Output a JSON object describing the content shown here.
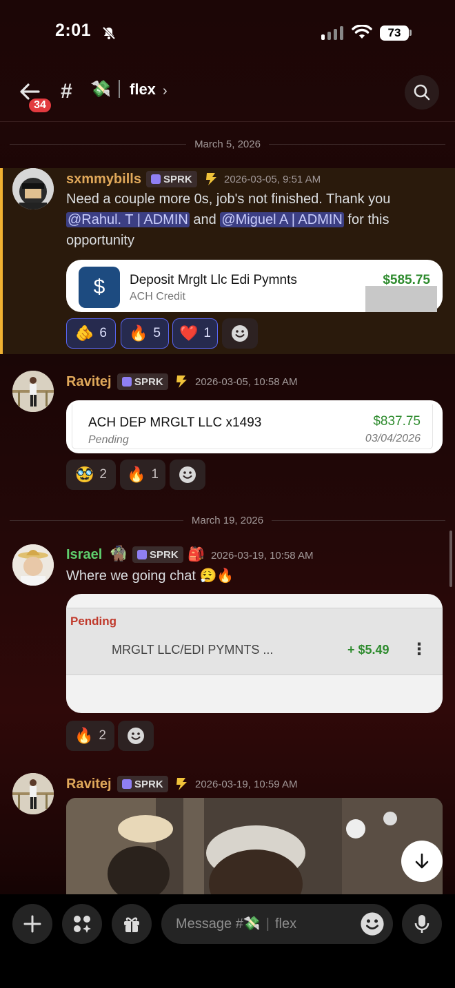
{
  "status_bar": {
    "time": "2:01",
    "battery": "73"
  },
  "header": {
    "back_badge": "34",
    "hash": "#",
    "channel_emoji": "💸",
    "channel_name": "flex",
    "chevron": "›"
  },
  "dividers": [
    "March 5, 2026",
    "March 19, 2026"
  ],
  "messages": [
    {
      "author": "sxmmybills",
      "author_color": "#e0a85a",
      "tag": "SPRK",
      "timestamp": "2026-03-05, 9:51 AM",
      "text_parts": {
        "t1": "Need a couple more 0s, job's not finished. Thank you",
        "mention1": "@Rahul. T | ADMIN",
        "t2": " and ",
        "mention2": "@Miguel A | ADMIN",
        "t3": " for this",
        "t4": "opportunity"
      },
      "card": {
        "title": "Deposit Mrglt Llc Edi Pymnts",
        "subtitle": "ACH Credit",
        "amount": "$585.75",
        "icon": "$"
      },
      "reactions": [
        {
          "emoji": "🫵",
          "count": "6"
        },
        {
          "emoji": "🔥",
          "count": "5"
        },
        {
          "emoji": "❤️",
          "count": "1"
        }
      ]
    },
    {
      "author": "Ravitej",
      "author_color": "#e0a85a",
      "tag": "SPRK",
      "timestamp": "2026-03-05, 10:58 AM",
      "card": {
        "title": "ACH DEP MRGLT LLC x1493",
        "status": "Pending",
        "amount": "$837.75",
        "date": "03/04/2026"
      },
      "reactions": [
        {
          "emoji": "🥸",
          "count": "2"
        },
        {
          "emoji": "🔥",
          "count": "1"
        }
      ]
    },
    {
      "author": "Israel",
      "author_color": "#5fd16e",
      "author_emoji": "🧌",
      "tag": "SPRK",
      "tag_emoji": "🎒",
      "timestamp": "2026-03-19, 10:58 AM",
      "text": "Where we going chat 😮‍💨🔥",
      "card": {
        "status": "Pending",
        "title": "MRGLT LLC/EDI PYMNTS ...",
        "amount": "+ $5.49",
        "more": "⋮"
      },
      "reactions": [
        {
          "emoji": "🔥",
          "count": "2"
        }
      ]
    },
    {
      "author": "Ravitej",
      "author_color": "#e0a85a",
      "tag": "SPRK",
      "timestamp": "2026-03-19, 10:59 AM"
    }
  ],
  "composer": {
    "placeholder_prefix": "Message #",
    "placeholder_emoji": "💸",
    "placeholder_channel": "flex"
  },
  "colors": {
    "accent": "#5865f2",
    "money_green": "#2e8b2e",
    "pending_red": "#c0392b",
    "badge_red": "#e23a3f"
  }
}
